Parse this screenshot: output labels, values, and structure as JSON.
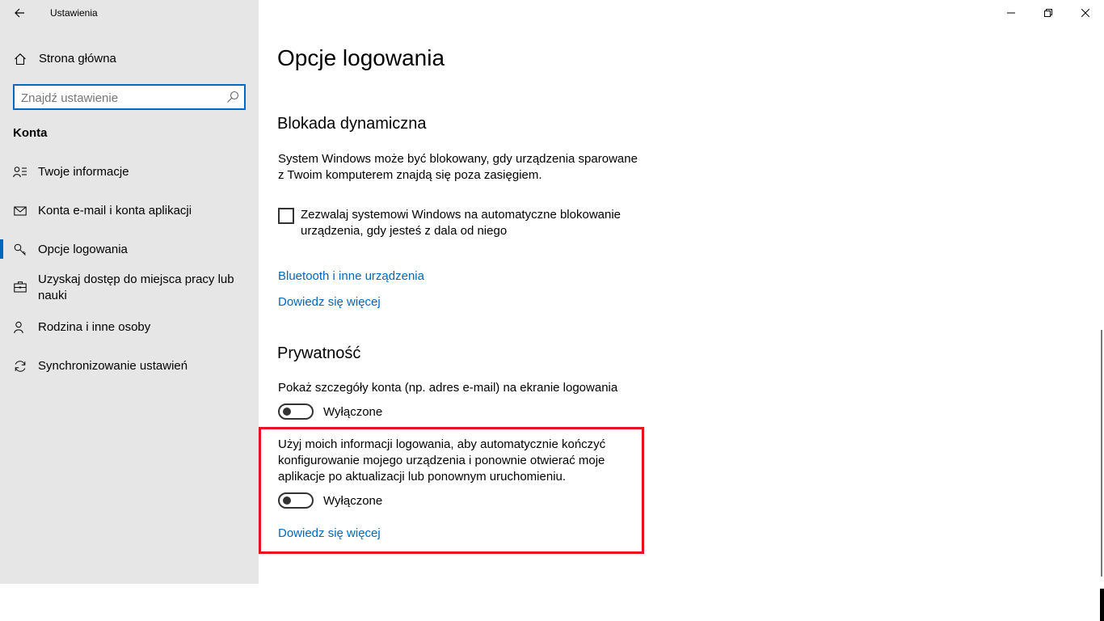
{
  "window": {
    "app_title": "Ustawienia"
  },
  "sidebar": {
    "home_label": "Strona główna",
    "search": {
      "placeholder": "Znajdź ustawienie",
      "value": ""
    },
    "section_header": "Konta",
    "items": [
      {
        "label": "Twoje informacje",
        "icon": "person-info-icon"
      },
      {
        "label": "Konta e-mail i konta aplikacji",
        "icon": "mail-icon"
      },
      {
        "label": "Opcje logowania",
        "icon": "key-icon",
        "active": true
      },
      {
        "label_line1": "Uzyskaj dostęp do miejsca pracy lub",
        "label_line2": "nauki",
        "icon": "briefcase-icon"
      },
      {
        "label": "Rodzina i inne osoby",
        "icon": "person-add-icon"
      },
      {
        "label": "Synchronizowanie ustawień",
        "icon": "sync-icon"
      }
    ]
  },
  "main": {
    "page_title": "Opcje logowania",
    "dynamic_lock": {
      "title": "Blokada dynamiczna",
      "desc_line1": "System Windows może być blokowany, gdy urządzenia sparowane",
      "desc_line2": "z Twoim komputerem znajdą się poza zasięgiem.",
      "checkbox_line1": "Zezwalaj systemowi Windows na automatyczne blokowanie",
      "checkbox_line2": "urządzenia, gdy jesteś z dala od niego",
      "checkbox_checked": false,
      "link_bluetooth": "Bluetooth i inne urządzenia",
      "link_learn_more": "Dowiedz się więcej"
    },
    "privacy": {
      "title": "Prywatność",
      "setting1_label": "Pokaż szczegóły konta (np. adres e-mail) na ekranie logowania",
      "setting1_state": "Wyłączone",
      "setting2_line1": "Użyj moich informacji logowania, aby automatycznie kończyć",
      "setting2_line2": "konfigurowanie mojego urządzenia i ponownie otwierać moje",
      "setting2_line3": "aplikacje po aktualizacji lub ponownym uruchomieniu.",
      "setting2_state": "Wyłączone",
      "link_learn_more": "Dowiedz się więcej"
    }
  },
  "colors": {
    "accent": "#0067c0",
    "highlight": "#e81123",
    "sidebar_bg": "#e6e6e6"
  }
}
